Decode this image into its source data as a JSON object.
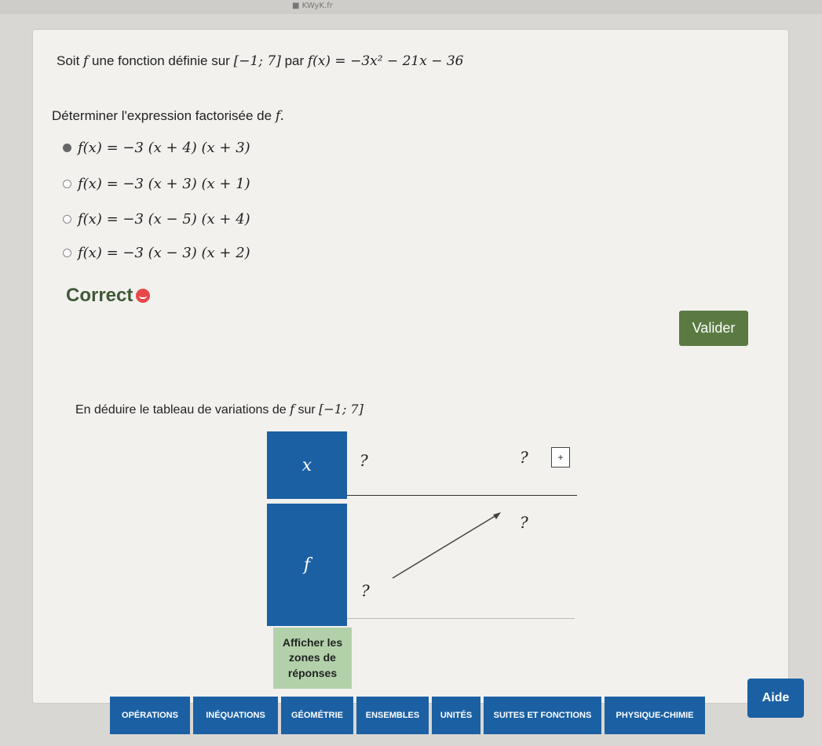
{
  "status_bar": {
    "text": "■ KWyK.fr"
  },
  "question1": {
    "prefix": "Soit ",
    "f": "f",
    "mid": " une fonction définie sur ",
    "interval": "[−1; 7]",
    "par": " par ",
    "formula": "f(x) = −3x² − 21x − 36"
  },
  "question2": {
    "text": "Déterminer l'expression factorisée de ",
    "f": "f."
  },
  "options": [
    {
      "label": "f(x) = −3 (x + 4) (x + 3)",
      "checked": true
    },
    {
      "label": "f(x) = −3 (x + 3) (x + 1)",
      "checked": false
    },
    {
      "label": "f(x) = −3 (x − 5) (x + 4)",
      "checked": false
    },
    {
      "label": "f(x) = −3 (x − 3) (x + 2)",
      "checked": false
    }
  ],
  "feedback": {
    "label": "Correct"
  },
  "validate_button": {
    "label": "Valider"
  },
  "question3": {
    "text": "En déduire le tableau de variations de ",
    "f": "f",
    "sur": " sur ",
    "interval": "[−1; 7]"
  },
  "table": {
    "x_label": "x",
    "f_label": "f",
    "x_start": "?",
    "x_end": "?",
    "f_top": "?",
    "f_bottom": "?",
    "plus_label": "+"
  },
  "show_answers_button": {
    "line1": "Afficher les",
    "line2": "zones de",
    "line3": "réponses"
  },
  "nav": [
    {
      "label": "OPÉRATIONS"
    },
    {
      "label": "INÉQUATIONS"
    },
    {
      "label": "GÉOMÉTRIE"
    },
    {
      "label": "ENSEMBLES"
    },
    {
      "label": "UNITÉS"
    },
    {
      "label": "SUITES ET FONCTIONS"
    },
    {
      "label": "PHYSIQUE-CHIMIE"
    }
  ],
  "help_button": {
    "label": "Aide"
  },
  "colors": {
    "accent": "#1b60a3",
    "validate": "#5a7a42",
    "correct": "#3f5a37",
    "show_answers": "#b2d1aa"
  }
}
